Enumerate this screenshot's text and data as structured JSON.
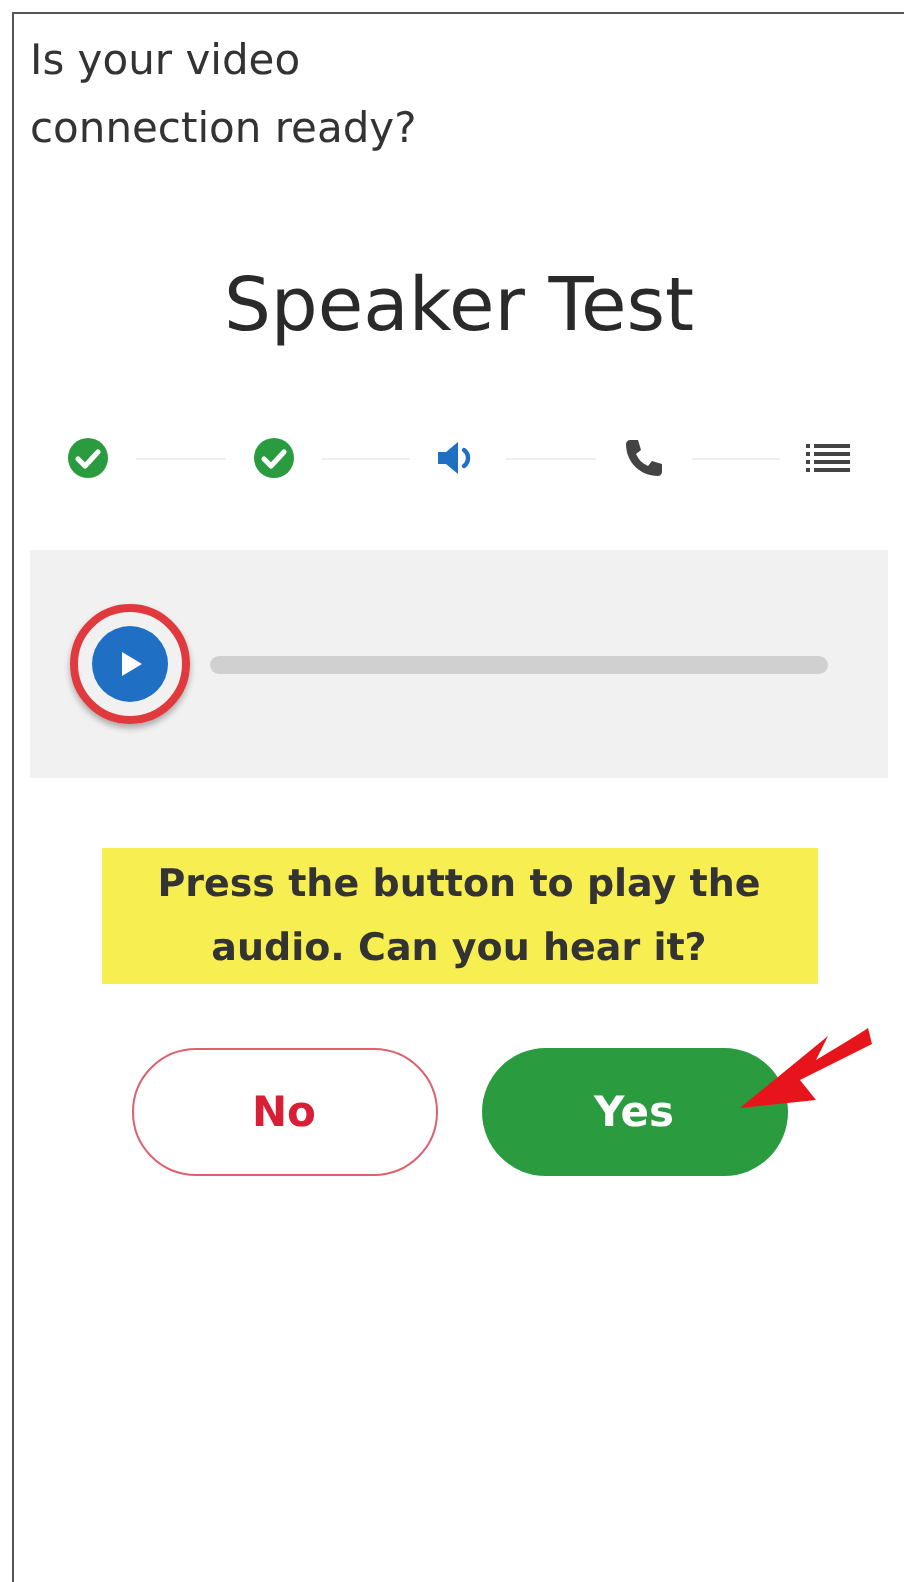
{
  "heading": "Is your video connection ready?",
  "title": "Speaker Test",
  "steps": [
    {
      "kind": "check",
      "current": false
    },
    {
      "kind": "check",
      "current": false
    },
    {
      "kind": "speaker",
      "current": true
    },
    {
      "kind": "phone",
      "current": false
    },
    {
      "kind": "list",
      "current": false
    }
  ],
  "player": {
    "play_button": {
      "highlighted": true
    }
  },
  "instruction": {
    "text": "Press the button to play the audio. Can you hear it?",
    "highlighted": true
  },
  "answers": [
    {
      "label": "No",
      "kind": "outline",
      "pointed": false
    },
    {
      "label": "Yes",
      "kind": "filled",
      "pointed": true
    }
  ]
}
